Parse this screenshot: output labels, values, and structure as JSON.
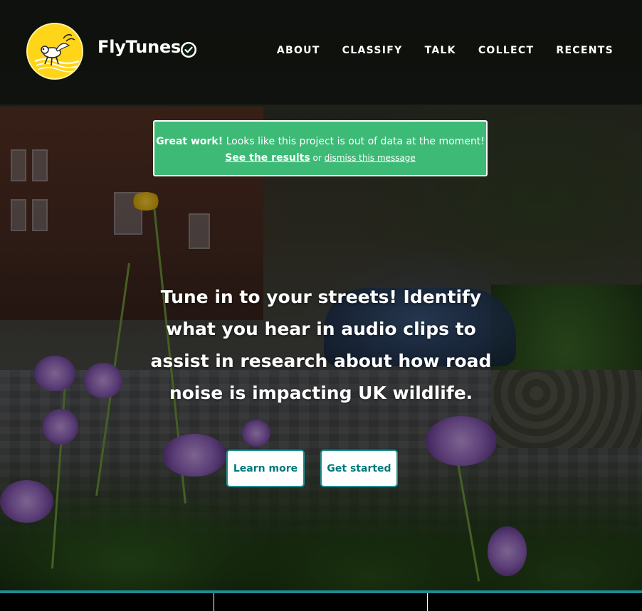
{
  "brand": {
    "name": "FlyTunes",
    "logo": "flytunes-logo-icon",
    "verified": "verified-check-icon"
  },
  "nav": [
    {
      "label": "ABOUT"
    },
    {
      "label": "CLASSIFY"
    },
    {
      "label": "TALK"
    },
    {
      "label": "COLLECT"
    },
    {
      "label": "RECENTS"
    }
  ],
  "notice": {
    "strong": "Great work!",
    "message": " Looks like this project is out of data at the moment!",
    "results_link": "See the results",
    "or_text": " or ",
    "dismiss_link": "dismiss this message"
  },
  "hero": {
    "line1": "Tune in to your streets! Identify",
    "line2": "what you hear in audio clips to",
    "line3": "assist in research about how road",
    "line4": "noise is impacting UK wildlife."
  },
  "buttons": {
    "learn_more": "Learn more",
    "get_started": "Get started"
  },
  "colors": {
    "notice_bg": "#3dba76",
    "button_text": "#00787b",
    "button_border": "#1f8f8f",
    "logo_bg": "#ffd51a",
    "teal_line": "#1e8a93"
  }
}
